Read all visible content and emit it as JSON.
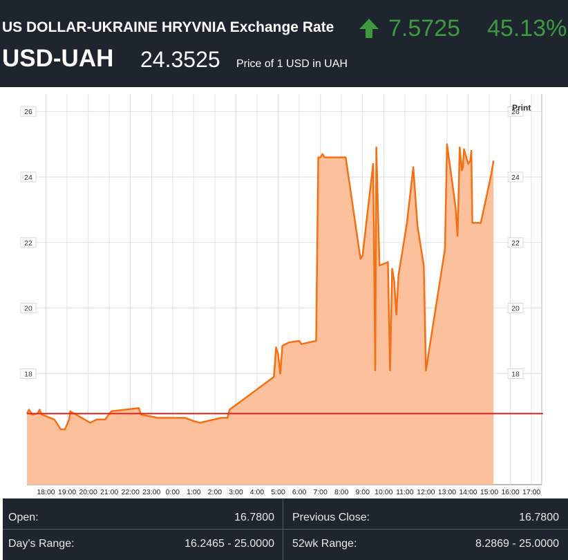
{
  "header": {
    "title": "US DOLLAR-UKRAINE HRYVNIA Exchange Rate",
    "change": "7.5725",
    "change_pct": "45.13%",
    "symbol": "USD-UAH",
    "price": "24.3525",
    "price_desc": "Price of 1 USD in UAH",
    "arrow_icon": "up-arrow-icon",
    "up_color": "#3d9a3f"
  },
  "print_label": "Print",
  "chart_data": {
    "type": "area",
    "xlabel": "",
    "ylabel": "",
    "x_ticks": [
      "18:00",
      "19:00",
      "20:00",
      "21:00",
      "22:00",
      "23:00",
      "0:00",
      "1:00",
      "2:00",
      "3:00",
      "4:00",
      "5:00",
      "6:00",
      "7:00",
      "8:00",
      "9:00",
      "10:00",
      "11:00",
      "12:00",
      "13:00",
      "14:00",
      "15:00",
      "16:00",
      "17:00"
    ],
    "y_ticks": [
      "18",
      "20",
      "22",
      "24",
      "26"
    ],
    "ylim": [
      16.0,
      27.2
    ],
    "x_range_hours": [
      17.1,
      41.5
    ],
    "grid": true,
    "line_color": "#f56f13",
    "fill_color": "#fdc09c",
    "reference_line": {
      "value": 16.78,
      "label": "Previous Close",
      "color": "#e8221c"
    },
    "series": [
      {
        "points": [
          [
            17.1,
            16.78
          ],
          [
            17.2,
            16.9
          ],
          [
            17.35,
            16.75
          ],
          [
            17.6,
            16.78
          ],
          [
            17.7,
            16.9
          ],
          [
            17.8,
            16.75
          ],
          [
            18.4,
            16.6
          ],
          [
            18.7,
            16.3
          ],
          [
            18.9,
            16.3
          ],
          [
            19.1,
            16.6
          ],
          [
            19.15,
            16.85
          ],
          [
            20.1,
            16.5
          ],
          [
            20.4,
            16.6
          ],
          [
            20.8,
            16.6
          ],
          [
            21.1,
            16.85
          ],
          [
            22.4,
            16.95
          ],
          [
            22.5,
            16.75
          ],
          [
            22.9,
            16.7
          ],
          [
            23.3,
            16.65
          ],
          [
            24.6,
            16.65
          ],
          [
            25.0,
            16.55
          ],
          [
            25.3,
            16.5
          ],
          [
            26.3,
            16.65
          ],
          [
            26.6,
            16.65
          ],
          [
            26.7,
            16.9
          ],
          [
            28.8,
            17.9
          ],
          [
            28.9,
            18.8
          ],
          [
            29.0,
            18.6
          ],
          [
            29.1,
            18.0
          ],
          [
            29.2,
            18.85
          ],
          [
            29.5,
            18.95
          ],
          [
            30.0,
            19.0
          ],
          [
            30.1,
            18.9
          ],
          [
            30.8,
            19.0
          ],
          [
            30.9,
            24.6
          ],
          [
            31.0,
            24.6
          ],
          [
            31.1,
            24.7
          ],
          [
            31.2,
            24.6
          ],
          [
            32.2,
            24.6
          ],
          [
            32.9,
            21.5
          ],
          [
            33.0,
            21.6
          ],
          [
            33.5,
            24.4
          ],
          [
            33.6,
            18.1
          ],
          [
            33.65,
            24.9
          ],
          [
            33.8,
            21.3
          ],
          [
            34.2,
            21.4
          ],
          [
            34.3,
            18.1
          ],
          [
            34.4,
            21.2
          ],
          [
            34.5,
            20.8
          ],
          [
            34.6,
            19.8
          ],
          [
            34.7,
            21.0
          ],
          [
            35.1,
            22.6
          ],
          [
            35.4,
            24.3
          ],
          [
            35.6,
            22.5
          ],
          [
            35.9,
            21.3
          ],
          [
            36.0,
            18.1
          ],
          [
            36.9,
            21.8
          ],
          [
            37.0,
            25.0
          ],
          [
            37.4,
            23.1
          ],
          [
            37.5,
            22.2
          ],
          [
            37.6,
            24.9
          ],
          [
            37.7,
            24.2
          ],
          [
            37.75,
            24.3
          ],
          [
            37.8,
            24.85
          ],
          [
            38.0,
            24.4
          ],
          [
            38.1,
            24.5
          ],
          [
            38.15,
            24.8
          ],
          [
            38.2,
            22.6
          ],
          [
            38.6,
            22.6
          ],
          [
            39.1,
            24.1
          ],
          [
            39.2,
            24.5
          ]
        ]
      }
    ]
  },
  "stats": {
    "open_label": "Open:",
    "open_value": "16.7800",
    "prev_close_label": "Previous Close:",
    "prev_close_value": "16.7800",
    "days_range_label": "Day's Range:",
    "days_range_value": "16.2465 - 25.0000",
    "wk52_range_label": "52wk Range:",
    "wk52_range_value": "8.2869 - 25.0000"
  }
}
